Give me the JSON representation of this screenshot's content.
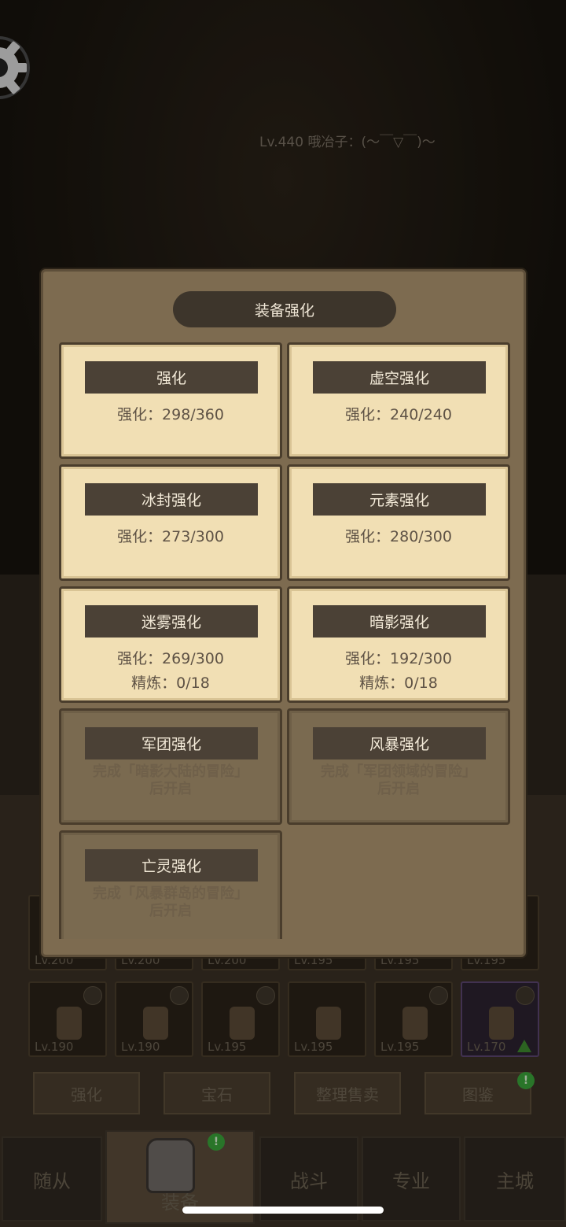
{
  "player": {
    "name": "Lv.440 哦冶子：(～￣▽￣)～"
  },
  "modal": {
    "title": "装备强化",
    "cards": [
      {
        "name": "强化",
        "line1": "强化：298/360",
        "line2": "",
        "locked": false
      },
      {
        "name": "虚空强化",
        "line1": "强化：240/240",
        "line2": "",
        "locked": false
      },
      {
        "name": "冰封强化",
        "line1": "强化：273/300",
        "line2": "",
        "locked": false
      },
      {
        "name": "元素强化",
        "line1": "强化：280/300",
        "line2": "",
        "locked": false
      },
      {
        "name": "迷雾强化",
        "line1": "强化：269/300",
        "line2": "精炼：0/18",
        "locked": false
      },
      {
        "name": "暗影强化",
        "line1": "强化：192/300",
        "line2": "精炼：0/18",
        "locked": false
      },
      {
        "name": "军团强化",
        "line1": "完成「暗影大陆的冒险」",
        "line2": "后开启",
        "locked": true
      },
      {
        "name": "风暴强化",
        "line1": "完成「军团领域的冒险」",
        "line2": "后开启",
        "locked": true
      },
      {
        "name": "亡灵强化",
        "line1": "完成「风暴群岛的冒险」",
        "line2": "后开启",
        "locked": true
      }
    ]
  },
  "equipment_rows": [
    {
      "levels": [
        "Lv.200",
        "Lv.200",
        "Lv.200",
        "Lv.195",
        "Lv.195",
        "Lv.195"
      ]
    },
    {
      "levels": [
        "Lv.190",
        "Lv.190",
        "Lv.195",
        "Lv.195",
        "Lv.195",
        "Lv.170"
      ]
    }
  ],
  "sub_tabs": [
    "强化",
    "宝石",
    "整理售卖",
    "图鉴"
  ],
  "bottom_nav": [
    "随从",
    "装备",
    "战斗",
    "专业",
    "主城"
  ],
  "badge_mark": "!",
  "colors": {
    "card_bg": "#f1dfb4",
    "modal_bg": "#7d6b50",
    "badge": "#3aa23a"
  }
}
